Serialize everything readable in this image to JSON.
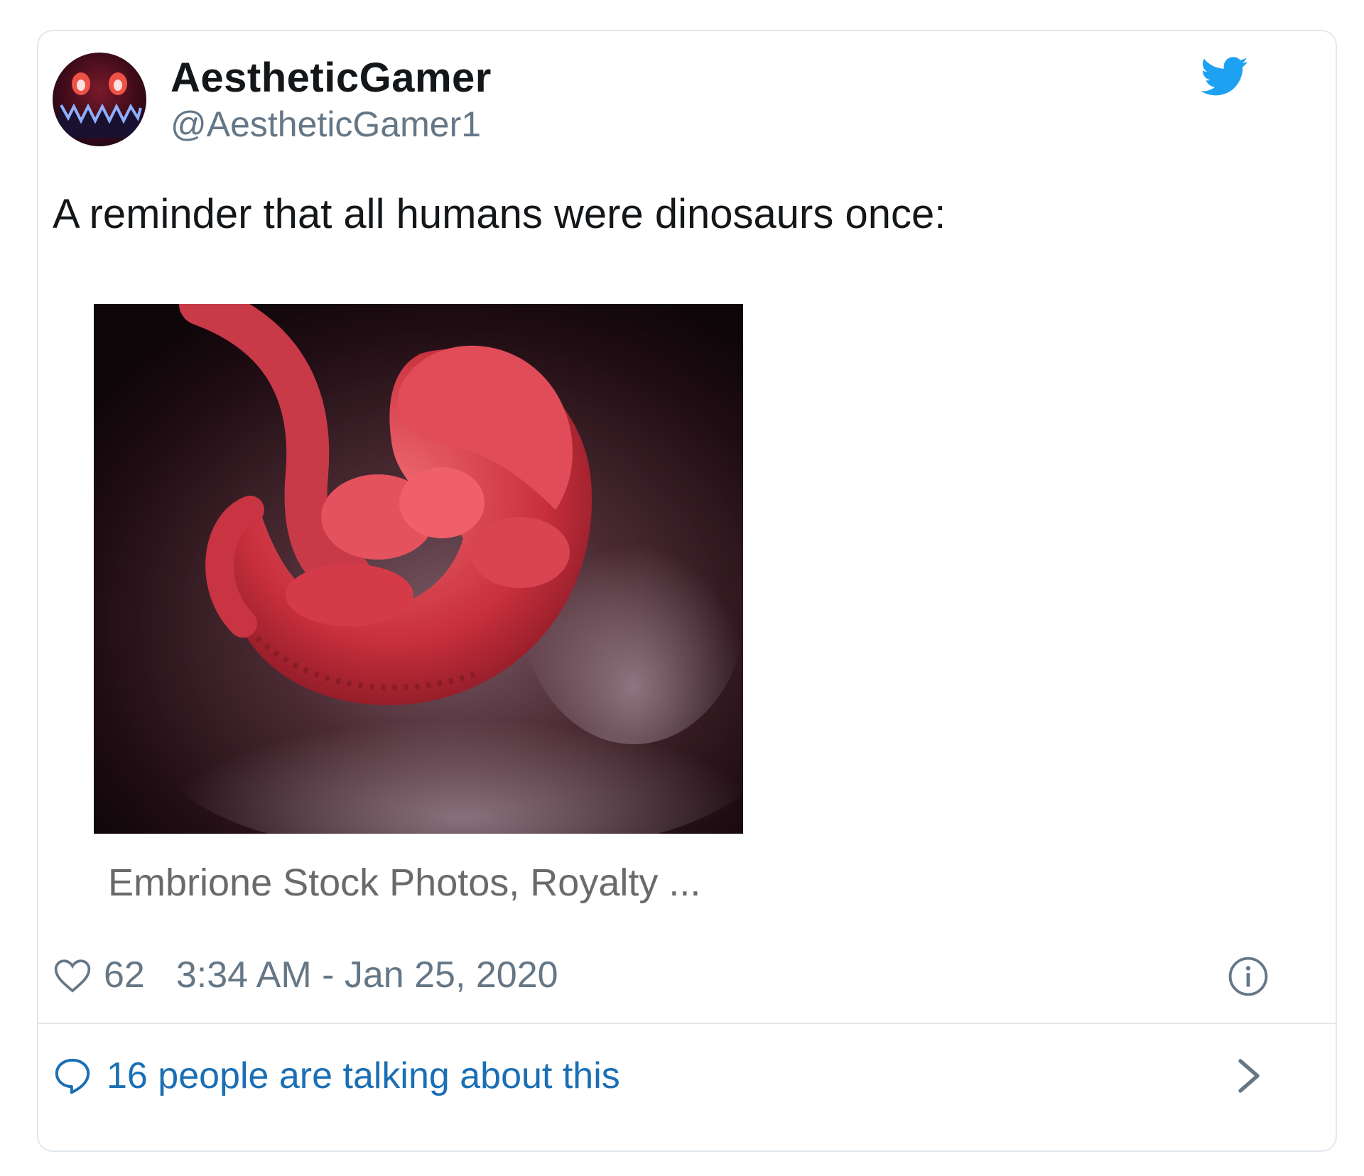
{
  "tweet": {
    "author": {
      "display_name": "AestheticGamer",
      "handle": "@AestheticGamer1",
      "avatar_icon": "monster-face-avatar"
    },
    "brand_icon": "twitter-bird-icon",
    "brand_color": "#1da1f2",
    "text": "A reminder that all humans were dinosaurs once:",
    "media": {
      "caption": "Embrione Stock Photos, Royalty ..."
    },
    "likes": "62",
    "timestamp": "3:34 AM - Jan 25, 2020",
    "conversation": {
      "label": "16 people are talking about this",
      "color": "#1b6fb5"
    }
  }
}
